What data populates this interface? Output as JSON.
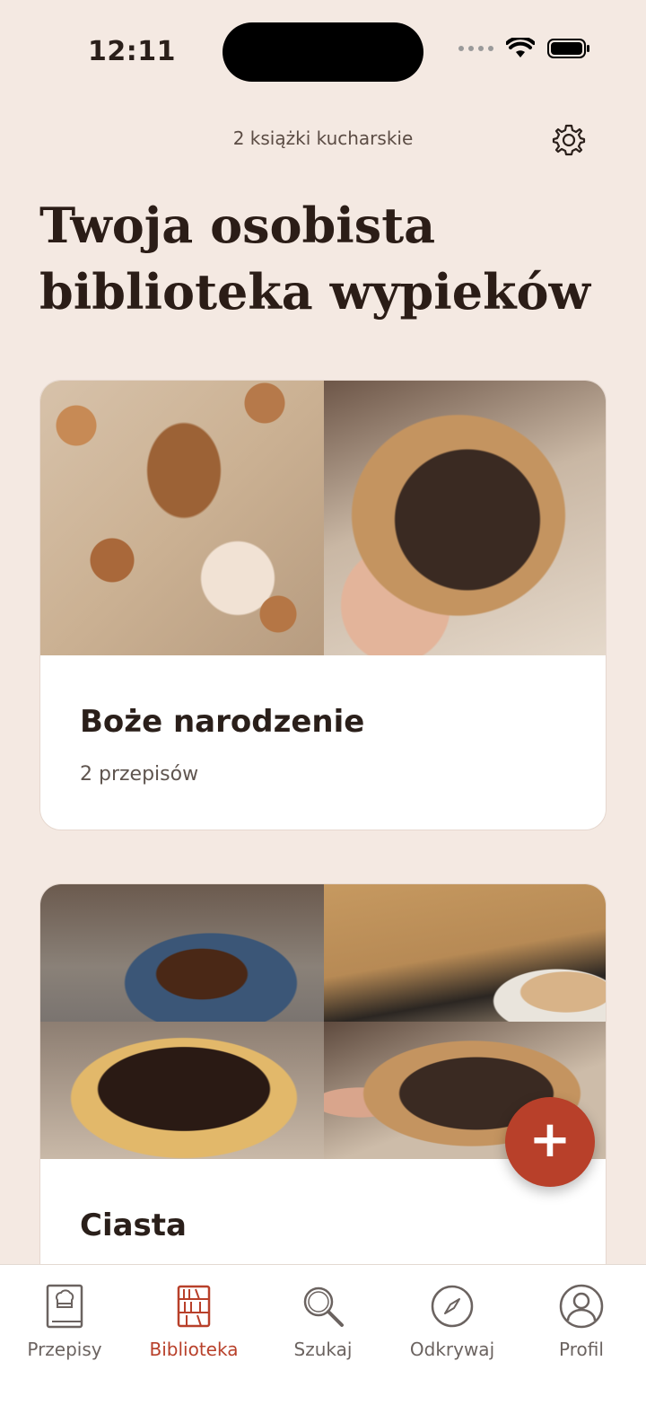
{
  "status_bar": {
    "time": "12:11"
  },
  "header": {
    "subtitle": "2 książki kucharskie",
    "settings_icon": "gear-icon"
  },
  "page": {
    "title": "Twoja osobista biblioteka wypieków"
  },
  "cookbooks": [
    {
      "title": "Boże narodzenie",
      "count_label": "2 przepisów"
    },
    {
      "title": "Ciasta"
    }
  ],
  "fab": {
    "label": "+"
  },
  "tabbar": {
    "items": [
      {
        "label": "Przepisy",
        "icon": "book-chef-icon"
      },
      {
        "label": "Biblioteka",
        "icon": "bookshelf-icon",
        "active": true
      },
      {
        "label": "Szukaj",
        "icon": "search-icon"
      },
      {
        "label": "Odkrywaj",
        "icon": "compass-icon"
      },
      {
        "label": "Profil",
        "icon": "profile-icon"
      }
    ]
  },
  "colors": {
    "accent": "#b8402a",
    "background": "#f4e9e2",
    "text": "#2a1f1a"
  }
}
